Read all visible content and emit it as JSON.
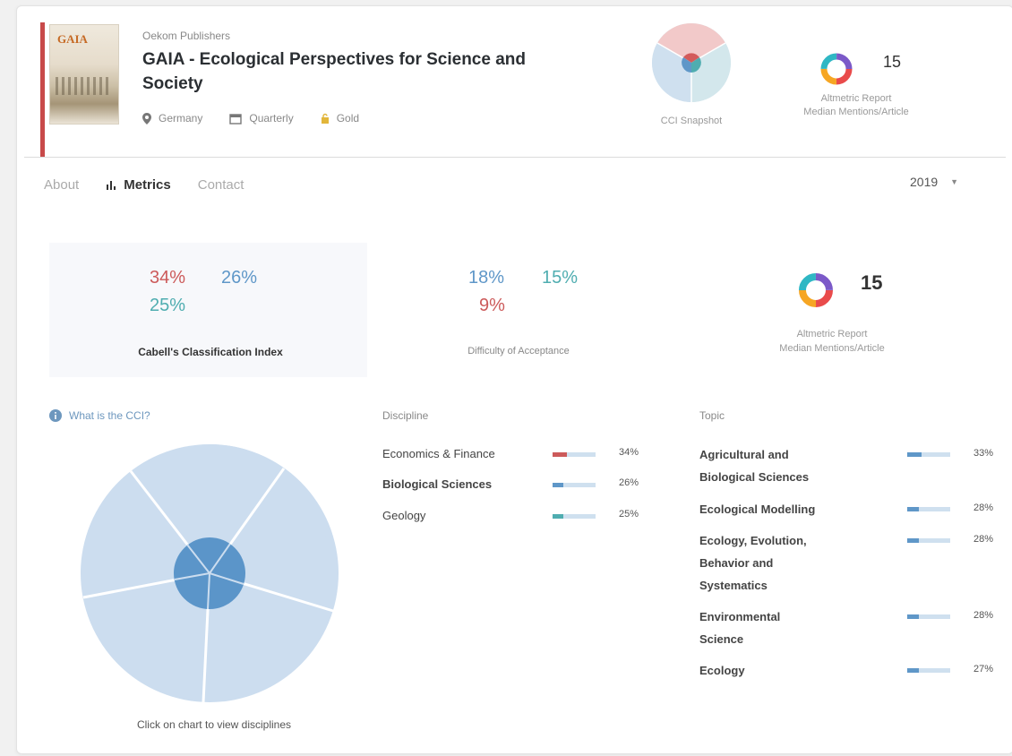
{
  "journal": {
    "publisher": "Oekom Publishers",
    "title": "GAIA - Ecological Perspectives for Science and Society",
    "country": "Germany",
    "frequency": "Quarterly",
    "access": "Gold",
    "cover_text": "GAIA"
  },
  "header": {
    "cci_snapshot_label": "CCI Snapshot",
    "altmetric_value": "15",
    "altmetric_label_1": "Altmetric Report",
    "altmetric_label_2": "Median Mentions/Article"
  },
  "tabs": {
    "items": [
      {
        "label": "About",
        "active": false
      },
      {
        "label": "Metrics",
        "active": true
      },
      {
        "label": "Contact",
        "active": false
      }
    ],
    "year": "2019"
  },
  "stats": {
    "cci": {
      "values": [
        "34%",
        "26%",
        "25%"
      ],
      "label": "Cabell's Classification Index"
    },
    "difficulty": {
      "values": [
        "18%",
        "15%",
        "9%"
      ],
      "label": "Difficulty of Acceptance"
    },
    "altmetric": {
      "value": "15",
      "label_1": "Altmetric Report",
      "label_2": "Median Mentions/Article"
    }
  },
  "cci_help": {
    "label": "What is the CCI?"
  },
  "pie": {
    "hint": "Click on chart to view disciplines"
  },
  "discipline": {
    "heading": "Discipline",
    "rows": [
      {
        "name": "Economics & Finance",
        "value": "34%",
        "percent": 34,
        "color": "#cc5a5a"
      },
      {
        "name": "Biological Sciences",
        "value": "26%",
        "percent": 26,
        "color": "#5f97c8"
      },
      {
        "name": "Geology",
        "value": "25%",
        "percent": 25,
        "color": "#4fadb0"
      }
    ]
  },
  "topic": {
    "heading": "Topic",
    "rows": [
      {
        "name_lines": [
          "Agricultural and",
          "Biological Sciences"
        ],
        "value": "33%",
        "percent": 33
      },
      {
        "name_lines": [
          "Ecological Modelling"
        ],
        "value": "28%",
        "percent": 28
      },
      {
        "name_lines": [
          "Ecology, Evolution,",
          "Behavior and",
          "Systematics"
        ],
        "value": "28%",
        "percent": 28
      },
      {
        "name_lines": [
          "Environmental",
          "Science"
        ],
        "value": "28%",
        "percent": 28
      },
      {
        "name_lines": [
          "Ecology"
        ],
        "value": "27%",
        "percent": 27
      }
    ]
  },
  "colors": {
    "accent_red": "#cc5a5a",
    "accent_blue": "#5f97c8",
    "accent_teal": "#4fadb0",
    "pie_light": "#ccddef",
    "pie_dark": "#5b95c9"
  }
}
